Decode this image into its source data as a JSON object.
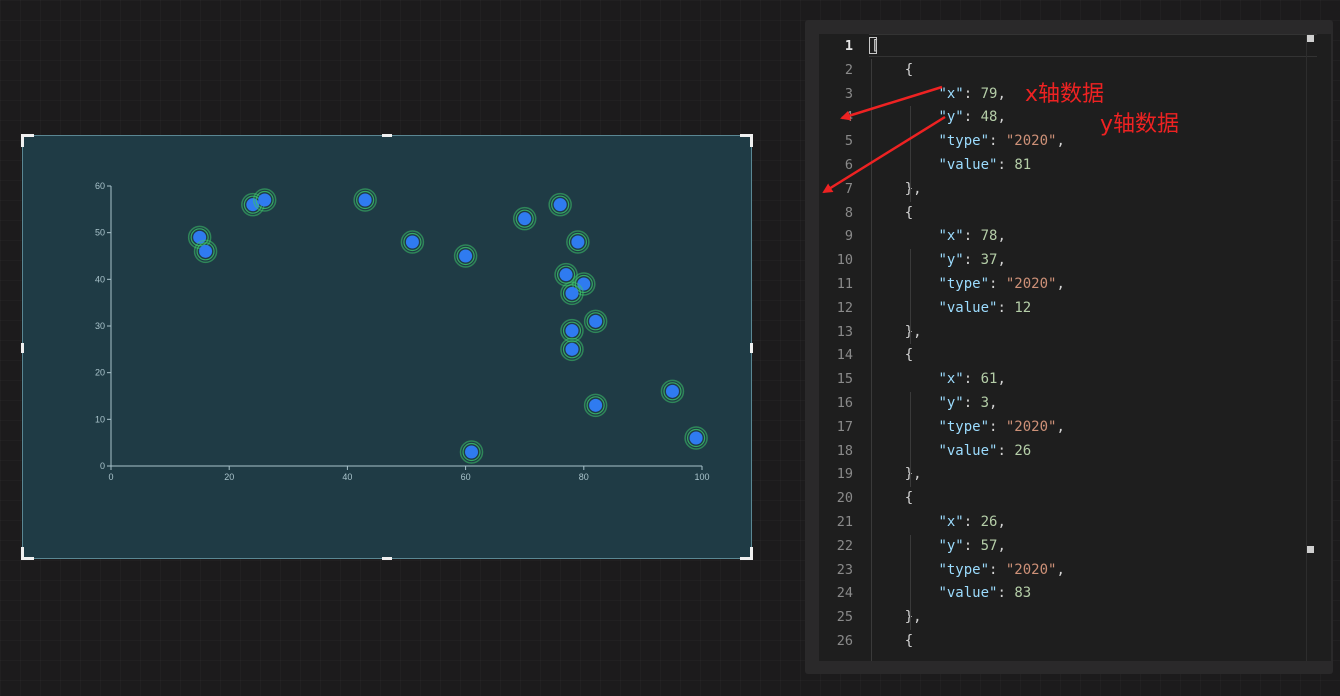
{
  "chart_data": {
    "type": "scatter",
    "title": "",
    "xlabel": "",
    "ylabel": "",
    "xlim": [
      0,
      100
    ],
    "ylim": [
      0,
      60
    ],
    "xticks": [
      0,
      20,
      40,
      60,
      80,
      100
    ],
    "yticks": [
      0,
      10,
      20,
      30,
      40,
      50,
      60
    ],
    "grid": false,
    "point_color": "#2f7bf0",
    "halo_color": "#3cc46a",
    "points": [
      {
        "x": 15,
        "y": 49
      },
      {
        "x": 16,
        "y": 46
      },
      {
        "x": 24,
        "y": 56
      },
      {
        "x": 26,
        "y": 57
      },
      {
        "x": 43,
        "y": 57
      },
      {
        "x": 51,
        "y": 48
      },
      {
        "x": 60,
        "y": 45
      },
      {
        "x": 70,
        "y": 53
      },
      {
        "x": 76,
        "y": 56
      },
      {
        "x": 79,
        "y": 48
      },
      {
        "x": 77,
        "y": 41
      },
      {
        "x": 80,
        "y": 39
      },
      {
        "x": 78,
        "y": 37
      },
      {
        "x": 82,
        "y": 31
      },
      {
        "x": 78,
        "y": 29
      },
      {
        "x": 78,
        "y": 25
      },
      {
        "x": 82,
        "y": 13
      },
      {
        "x": 95,
        "y": 16
      },
      {
        "x": 99,
        "y": 6
      },
      {
        "x": 61,
        "y": 3
      }
    ]
  },
  "editor": {
    "lines": [
      {
        "num": "1",
        "text": "["
      },
      {
        "num": "2",
        "text": "    {"
      },
      {
        "num": "3",
        "key": "\"x\"",
        "val": "79",
        "kind": "num"
      },
      {
        "num": "4",
        "key": "\"y\"",
        "val": "48",
        "kind": "num"
      },
      {
        "num": "5",
        "key": "\"type\"",
        "val": "\"2020\"",
        "kind": "str"
      },
      {
        "num": "6",
        "key": "\"value\"",
        "val": "81",
        "kind": "num",
        "last": true
      },
      {
        "num": "7",
        "text": "    },"
      },
      {
        "num": "8",
        "text": "    {"
      },
      {
        "num": "9",
        "key": "\"x\"",
        "val": "78",
        "kind": "num"
      },
      {
        "num": "10",
        "key": "\"y\"",
        "val": "37",
        "kind": "num"
      },
      {
        "num": "11",
        "key": "\"type\"",
        "val": "\"2020\"",
        "kind": "str"
      },
      {
        "num": "12",
        "key": "\"value\"",
        "val": "12",
        "kind": "num",
        "last": true
      },
      {
        "num": "13",
        "text": "    },"
      },
      {
        "num": "14",
        "text": "    {"
      },
      {
        "num": "15",
        "key": "\"x\"",
        "val": "61",
        "kind": "num"
      },
      {
        "num": "16",
        "key": "\"y\"",
        "val": "3",
        "kind": "num"
      },
      {
        "num": "17",
        "key": "\"type\"",
        "val": "\"2020\"",
        "kind": "str"
      },
      {
        "num": "18",
        "key": "\"value\"",
        "val": "26",
        "kind": "num",
        "last": true
      },
      {
        "num": "19",
        "text": "    },"
      },
      {
        "num": "20",
        "text": "    {"
      },
      {
        "num": "21",
        "key": "\"x\"",
        "val": "26",
        "kind": "num"
      },
      {
        "num": "22",
        "key": "\"y\"",
        "val": "57",
        "kind": "num"
      },
      {
        "num": "23",
        "key": "\"type\"",
        "val": "\"2020\"",
        "kind": "str"
      },
      {
        "num": "24",
        "key": "\"value\"",
        "val": "83",
        "kind": "num",
        "last": true
      },
      {
        "num": "25",
        "text": "    },"
      },
      {
        "num": "26",
        "text": "    {"
      }
    ]
  },
  "annotations": {
    "x_label": "x轴数据",
    "y_label": "y轴数据",
    "color": "#ee2222"
  }
}
